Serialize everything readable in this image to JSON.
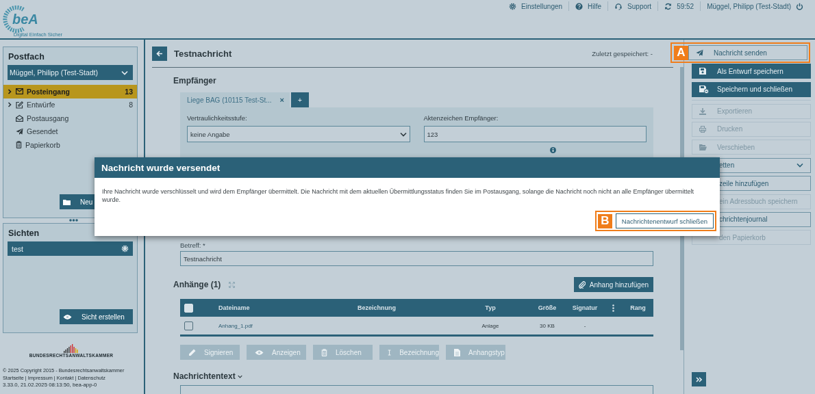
{
  "header": {
    "logo": {
      "wordmark": "beA",
      "tagline": "Digital Einfach Sicher"
    },
    "top_links": [
      {
        "label": "Einstellungen"
      },
      {
        "label": "Hilfe"
      },
      {
        "label": "Support"
      },
      {
        "label": "59:52"
      },
      {
        "label": "Müggel, Philipp (Test-Stadt)"
      }
    ]
  },
  "sidebar": {
    "postfach": {
      "title": "Postfach",
      "account": "Müggel, Philipp (Test-Stadt)",
      "folders": [
        {
          "label": "Posteingang",
          "count": "13",
          "expandable": true,
          "selected": true
        },
        {
          "label": "Entwürfe",
          "count": "8",
          "expandable": true,
          "selected": false
        },
        {
          "label": "Postausgang",
          "expandable": false,
          "selected": false
        },
        {
          "label": "Gesendet",
          "expandable": false,
          "selected": false
        },
        {
          "label": "Papierkorb",
          "expandable": false,
          "selected": false
        }
      ],
      "new_button": "Neu"
    },
    "sichten": {
      "title": "Sichten",
      "views": [
        {
          "label": "test"
        }
      ],
      "create_button": "Sicht erstellen"
    },
    "brand": "BUNDESRECHTSANWALTSKAMMER",
    "footer": {
      "copyright": "© 2025 Copyright 2015 - Bundesrechtsanwaltskammer",
      "links": [
        "Startseite",
        "Impressum",
        "Kontakt",
        "Datenschutz"
      ],
      "link_separator": "|",
      "version": "3.33.0, 21.02.2025 08:13:50, bea-app-0"
    }
  },
  "main": {
    "title": "Testnachricht",
    "last_saved": "Zuletzt gespeichert: -",
    "recipients": {
      "heading": "Empfänger",
      "tabs": [
        {
          "label": "Liege BAG (10115 Test-St...",
          "remove_icon": "×",
          "selected": true
        }
      ],
      "add_tab": "+",
      "confidentiality": {
        "label": "Vertraulichkeitsstufe:",
        "value": "keine Angabe"
      },
      "reference": {
        "label": "Aktenzeichen Empfänger:",
        "value": "123"
      }
    },
    "subject": {
      "label": "Betreff: *",
      "value": "Testnachricht"
    },
    "attachments": {
      "heading": "Anhänge (1)",
      "add_button": "Anhang hinzufügen",
      "header_checked": false,
      "columns": [
        "Dateiname",
        "Bezeichnung",
        "Typ",
        "Größe",
        "Signatur",
        "Rang"
      ],
      "rows": [
        {
          "checked": false,
          "cells": [
            "Anhang_1.pdf",
            "",
            "Anlage",
            "30 KB",
            "-",
            ""
          ]
        }
      ],
      "actions": [
        {
          "label": "Signieren",
          "disabled": true
        },
        {
          "label": "Anzeigen",
          "disabled": true
        },
        {
          "label": "Löschen",
          "disabled": true
        },
        {
          "label": "Bezeichnung",
          "disabled": true
        },
        {
          "label": "Anhangstyp",
          "disabled": true
        }
      ]
    },
    "message_heading": "Nachrichtentext"
  },
  "actions": [
    {
      "label": "Nachricht senden",
      "kind": "outline",
      "covered": false,
      "callout": "A"
    },
    {
      "label": "Als Entwurf speichern",
      "kind": "primary",
      "covered": false
    },
    {
      "label": "Speichern und schließen",
      "kind": "primary",
      "covered": false
    },
    {
      "label": "Exportieren",
      "kind": "disabled",
      "covered": false
    },
    {
      "label": "Drucken",
      "kind": "disabled",
      "covered": false
    },
    {
      "label": "Verschieben",
      "kind": "disabled",
      "covered": false
    },
    {
      "label": "etten",
      "kind": "dropdown",
      "covered": true
    },
    {
      "label": "zeile hinzufügen",
      "kind": "outline",
      "covered": true
    },
    {
      "label": "ein Adressbuch speichern",
      "kind": "disabled",
      "covered": true
    },
    {
      "label": "chrichtenjournal",
      "kind": "outline",
      "covered": true
    },
    {
      "label": "den Papierkorb",
      "kind": "disabled",
      "covered": true
    }
  ],
  "dialog": {
    "title": "Nachricht wurde versendet",
    "body": "Ihre Nachricht wurde verschlüsselt und wird dem Empfänger übermittelt. Die Nachricht mit dem aktuellen Übermittlungsstatus finden Sie im Postausgang, solange die Nachricht noch nicht an alle Empfänger übermittelt wurde.",
    "button": "Nachrichtenentwurf schließen",
    "callout": "B"
  }
}
